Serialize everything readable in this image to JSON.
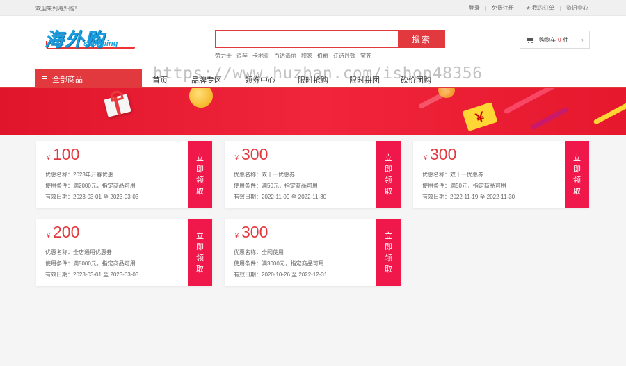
{
  "topbar": {
    "welcome": "欢迎来到海外购！",
    "links": [
      "登录",
      "免费注册",
      "我的订单",
      "资讯中心"
    ]
  },
  "logo": {
    "cn": "海外购",
    "en": "shopping"
  },
  "search": {
    "button": "搜索",
    "placeholder": "",
    "hotwords": [
      "劳力士",
      "浪琴",
      "卡地亚",
      "百达翡丽",
      "积家",
      "伯爵",
      "江诗丹顿",
      "宝齐"
    ]
  },
  "minicart": {
    "label": "购物车",
    "count": "0",
    "unit": "件"
  },
  "nav": {
    "all_categories": "全部商品",
    "items": [
      "首页",
      "品牌专区",
      "领券中心",
      "限时抢购",
      "限时拼团",
      "砍价团购"
    ]
  },
  "watermark": "https://www.huzhan.com/ishop48356",
  "coupon_labels": {
    "name": "优惠名称：",
    "condition": "使用条件：",
    "validity": "有效日期：",
    "claim": [
      "立",
      "即",
      "领",
      "取"
    ],
    "currency": "￥"
  },
  "coupons": [
    {
      "amount": "100",
      "name": "2023年开春优惠",
      "condition": "满2000元，指定商品可用",
      "validity": "2023-03-01 至 2023-03-03"
    },
    {
      "amount": "300",
      "name": "双十一优惠券",
      "condition": "满50元，指定商品可用",
      "validity": "2022-11-09 至 2022-11-30"
    },
    {
      "amount": "300",
      "name": "双十一优惠券",
      "condition": "满50元，指定商品可用",
      "validity": "2022-11-19 至 2022-11-30"
    },
    {
      "amount": "200",
      "name": "全店通用优惠券",
      "condition": "满5000元，指定商品可用",
      "validity": "2023-03-01 至 2023-03-03"
    },
    {
      "amount": "300",
      "name": "全网使用",
      "condition": "满3000元，指定商品可用",
      "validity": "2020-10-26 至 2022-12-31"
    }
  ],
  "colors": {
    "brand_red": "#e2393f",
    "claim_red": "#f0184b",
    "logo_blue": "#1a9ee0"
  }
}
